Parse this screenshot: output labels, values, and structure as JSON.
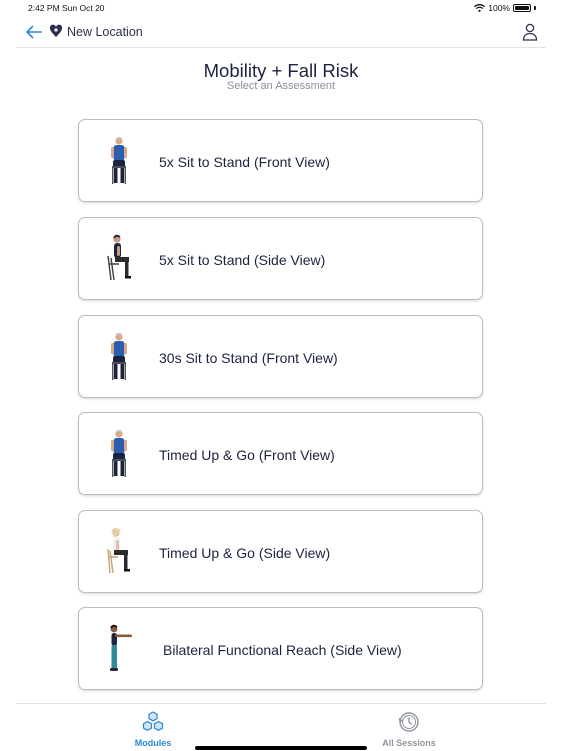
{
  "status": {
    "time": "2:42 PM",
    "date": "Sun Oct 20",
    "battery": "100%"
  },
  "nav": {
    "location_label": "New Location"
  },
  "header": {
    "title": "Mobility + Fall Risk",
    "subtitle": "Select an Assessment"
  },
  "assessments": [
    {
      "label": "5x Sit to Stand (Front View)"
    },
    {
      "label": "5x Sit to Stand (Side View)"
    },
    {
      "label": "30s Sit to Stand (Front View)"
    },
    {
      "label": "Timed Up & Go (Front View)"
    },
    {
      "label": "Timed Up & Go (Side View)"
    },
    {
      "label": "Bilateral Functional Reach (Side View)"
    }
  ],
  "tabs": [
    {
      "label": "Modules",
      "icon": "cubes-icon",
      "active": true
    },
    {
      "label": "All Sessions",
      "icon": "history-clock-icon",
      "active": false
    }
  ],
  "colors": {
    "accent": "#2a86d6",
    "text": "#1c2340",
    "muted": "#8a8f9c",
    "shirt_blue": "#2a5fb0"
  }
}
